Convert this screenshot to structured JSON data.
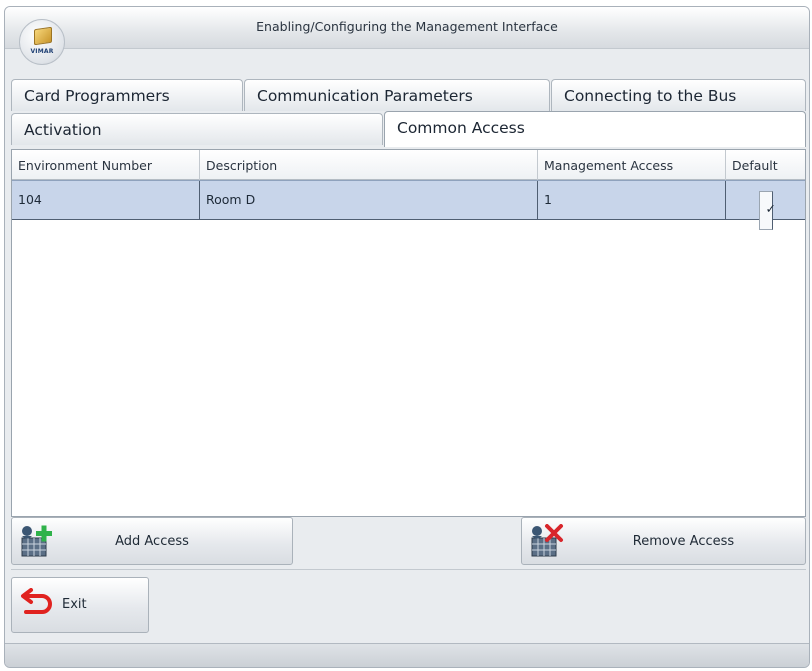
{
  "window": {
    "title": "Enabling/Configuring the Management Interface",
    "logo_brand": "VIMAR"
  },
  "tabs": [
    {
      "label": "Card Programmers"
    },
    {
      "label": "Communication Parameters"
    },
    {
      "label": "Connecting to the Bus"
    },
    {
      "label": "Activation"
    },
    {
      "label": "Common Access",
      "selected": true
    }
  ],
  "grid": {
    "columns": [
      "Environment Number",
      "Description",
      "Management Access",
      "Default"
    ],
    "rows": [
      {
        "environment_number": "104",
        "description": "Room D",
        "management_access": "1",
        "default": true
      }
    ],
    "checkmark": "✓"
  },
  "buttons": {
    "add_access": "Add Access",
    "remove_access": "Remove Access",
    "exit": "Exit"
  },
  "icons": {
    "add": "add-access-icon",
    "remove": "remove-access-icon",
    "exit": "back-arrow-icon"
  },
  "colors": {
    "selected_row": "#c8d5ea",
    "add_green": "#2fb24a",
    "remove_red": "#d8262c",
    "exit_red": "#e0221f"
  }
}
